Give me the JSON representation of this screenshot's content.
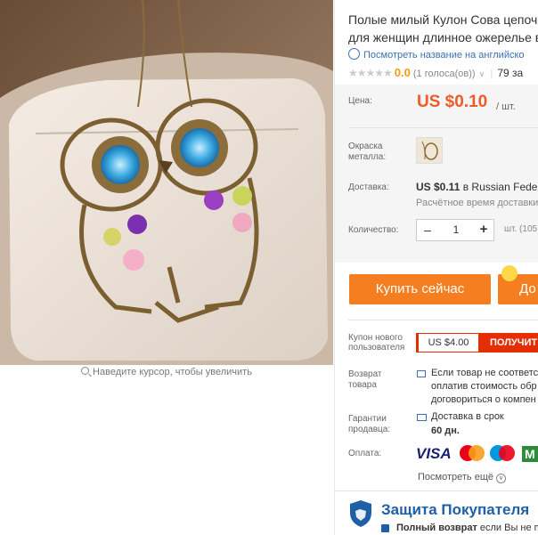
{
  "product": {
    "title_line1": "Полые милый Кулон Сова цепочк",
    "title_line2": "для женщин длинное ожерелье в",
    "translate_link": "Посмотреть название на английско",
    "rating_value": "0.0",
    "votes": "(1 голоса(ов))",
    "orders": "79 за",
    "zoom_hint": "Наведите курсор, чтобы увеличить"
  },
  "price": {
    "label": "Цена:",
    "value": "US $0.10",
    "unit": "/ шт."
  },
  "options": {
    "color_label": "Окраска металла:",
    "delivery_label": "Доставка:",
    "delivery_price": "US $0.11",
    "delivery_dest_prefix": " в ",
    "delivery_dest": "Russian Federa",
    "delivery_time": "Расчётное время доставки",
    "qty_label": "Количество:",
    "qty_minus": "–",
    "qty_value": "1",
    "qty_plus": "+",
    "qty_note": "шт. (105"
  },
  "actions": {
    "buy_now": "Купить сейчас",
    "add_to_cart": "До"
  },
  "coupon": {
    "label": "Купон нового пользователя",
    "amount": "US $4.00",
    "get": "ПОЛУЧИТ"
  },
  "returns": {
    "label": "Возврат товара",
    "line1": "Если товар не соответс",
    "line2": "оплатив стоимость обр",
    "line3": "договориться о компен"
  },
  "guarantee": {
    "label": "Гарантии продавца:",
    "text": "Доставка в срок",
    "days": "60 дн."
  },
  "payment": {
    "label": "Оплата:",
    "visa": "VISA",
    "see_all": "Посмотреть ещё",
    "chev": "v"
  },
  "buyer_protection": {
    "title": "Защита Покупателя",
    "full_refund": "Полный возврат",
    "refund_rest": " если Вы не по"
  },
  "colors": {
    "price": "#ef5a26",
    "button": "#f57e21",
    "coupon": "#e62e04",
    "link": "#3b6fb6",
    "protection": "#1e5fa8"
  }
}
